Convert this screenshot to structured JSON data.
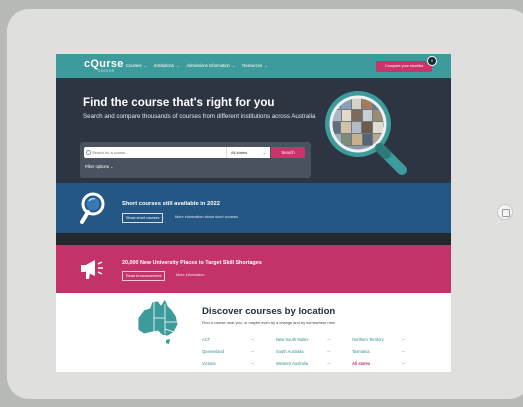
{
  "nav": {
    "logo_main": "cQurse",
    "logo_sub": "SEEKER",
    "links": [
      {
        "label": "Courses"
      },
      {
        "label": "Institutions"
      },
      {
        "label": "Admissions Information"
      },
      {
        "label": "Resources"
      }
    ],
    "compare_label": "Compare your shortlist",
    "compare_count": "0"
  },
  "hero": {
    "title": "Find the course that's right for you",
    "subtitle": "Search and compare thousands of courses from different institutions across Australia",
    "search_placeholder": "Search for a course...",
    "state_value": "All states",
    "search_button": "Search",
    "filter_label": "Filter options"
  },
  "short_courses": {
    "title": "Short courses still available in 2022",
    "button": "Show short courses",
    "link": "More information about short courses"
  },
  "announcement": {
    "title": "20,000 New University Places to Target Skill Shortages",
    "button": "Read Announcement",
    "link": "More information"
  },
  "discover": {
    "title": "Discover courses by location",
    "subtitle": "Find a course near you, or maybe even try a change and try somewhere new.",
    "locations": [
      {
        "label": "ACT"
      },
      {
        "label": "New South Wales"
      },
      {
        "label": "Northern Territory"
      },
      {
        "label": "Queensland"
      },
      {
        "label": "South Australia"
      },
      {
        "label": "Tasmania"
      },
      {
        "label": "Victoria"
      },
      {
        "label": "Western Australia"
      },
      {
        "label": "All states"
      }
    ],
    "arrow": "→"
  },
  "colors": {
    "teal": "#3e9b9b",
    "pink": "#c8356a",
    "navy": "#2e3542",
    "blue": "#245783"
  }
}
